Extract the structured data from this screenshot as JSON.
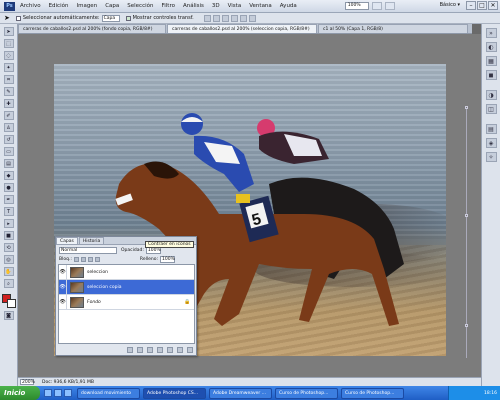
{
  "menubar": {
    "logo": "Ps",
    "items": [
      "Archivo",
      "Edición",
      "Imagen",
      "Capa",
      "Selección",
      "Filtro",
      "Análisis",
      "3D",
      "Vista",
      "Ventana",
      "Ayuda"
    ],
    "zoom": "100%",
    "workspace": "Básico ▾",
    "controls": [
      "–",
      "□",
      "✕"
    ]
  },
  "options_bar": {
    "auto_select_label": "Seleccionar automáticamente:",
    "auto_select_value": "Capa",
    "show_transform_label": "Mostrar controles transf."
  },
  "tabs": [
    {
      "label": "carreras de caballos2.psd al 200% (fondo copia, RGB/8#)",
      "active": false
    },
    {
      "label": "carreras de caballos2.psd al 200% (seleccion copia, RGB/8#)",
      "active": true
    },
    {
      "label": "c1 al 50% (Capa 1, RGB/8)",
      "active": false
    }
  ],
  "tooltip": "Contraer en iconos",
  "layers_panel": {
    "tabs": [
      "Capas",
      "Historia"
    ],
    "blend_mode": "Normal",
    "opacity_label": "Opacidad:",
    "opacity_value": "100%",
    "lock_label": "Bloq.:",
    "fill_label": "Relleno:",
    "fill_value": "100%",
    "layers": [
      {
        "name": "seleccion",
        "selected": false,
        "locked": false
      },
      {
        "name": "seleccion copia",
        "selected": true,
        "locked": false
      },
      {
        "name": "Fondo",
        "selected": false,
        "locked": true
      }
    ]
  },
  "photo": {
    "saddle_number": "5"
  },
  "statusbar": {
    "zoom": "200%",
    "doc_info": "Doc: 936,6 KB/1,91 MB"
  },
  "taskbar": {
    "start_label": "Inicio",
    "tasks": [
      {
        "label": "download movimiento",
        "active": false
      },
      {
        "label": "Adobe Photoshop CS...",
        "active": true
      },
      {
        "label": "Adobe Dreamweaver ...",
        "active": false
      },
      {
        "label": "Curso de Photoshop...",
        "active": false
      },
      {
        "label": "Curso de Photoshop...",
        "active": false
      }
    ],
    "time": "18:16"
  }
}
